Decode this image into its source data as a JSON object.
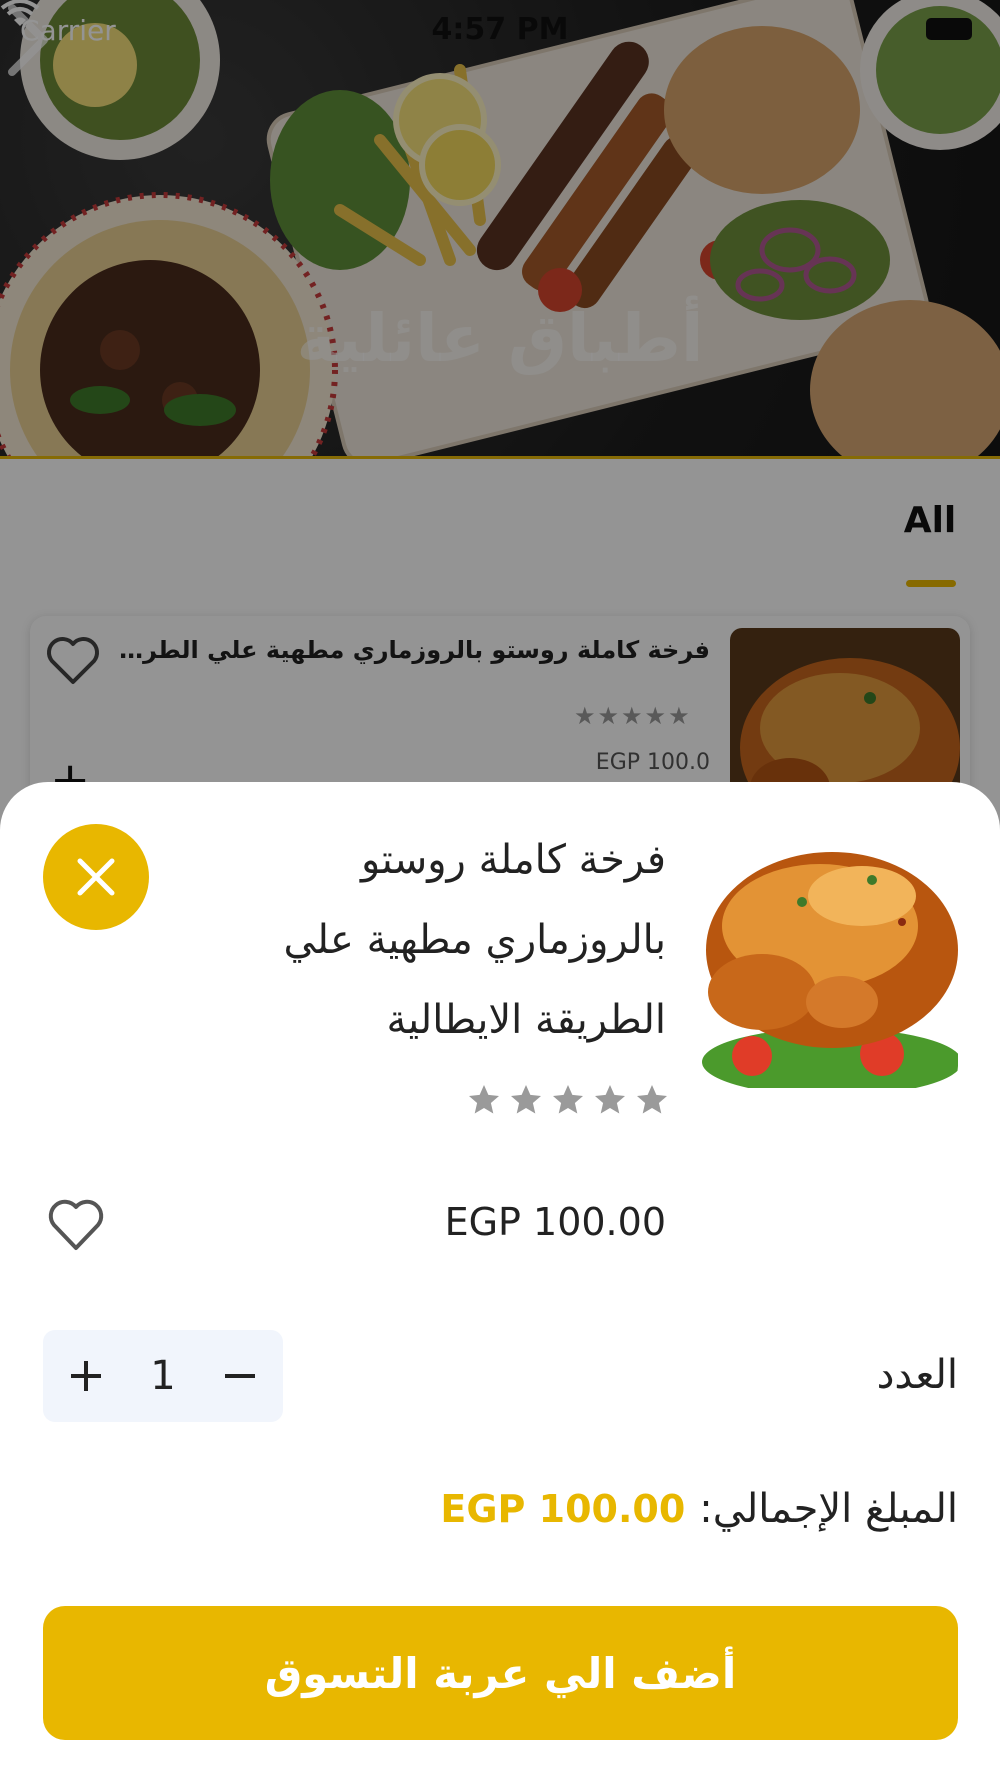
{
  "status_bar": {
    "carrier": "Carrier",
    "time": "4:57 PM"
  },
  "hero": {
    "title": "أطباق عائلية"
  },
  "tabs": [
    {
      "label": "All",
      "selected": true
    }
  ],
  "menu_item": {
    "name": "فرخة كاملة روستو بالروزماري مطهية علي الطري...",
    "stars": "★★★★★",
    "price": "EGP 100.0"
  },
  "sheet": {
    "title": "فرخة كاملة روستو بالروزماري مطهية علي الطريقة الايطالية",
    "rating": 0,
    "unit_price": "EGP 100.00",
    "quantity_label": "العدد",
    "quantity": "1",
    "total_label": "المبلغ الإجمالي:",
    "total_value": "EGP 100.00",
    "add_to_cart_label": "أضف الي عربة التسوق"
  },
  "colors": {
    "accent": "#E8B700",
    "stepper_bg": "#F1F5FC",
    "star_inactive": "#9A9A9A"
  },
  "icons": [
    "wifi-icon",
    "battery-icon",
    "chevron-right-icon",
    "heart-outline-icon",
    "plus-icon",
    "minus-icon",
    "close-icon",
    "star-icon"
  ]
}
